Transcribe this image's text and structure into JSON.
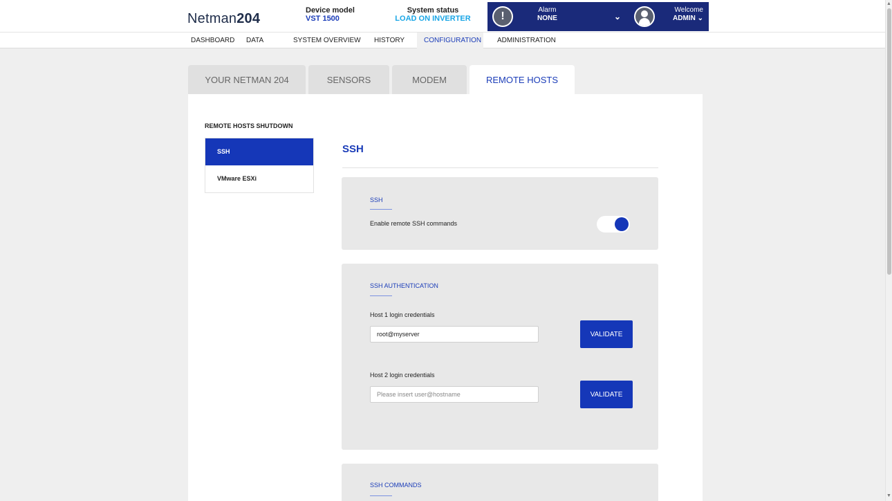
{
  "header": {
    "logo_text": "Netman",
    "logo_num": "204",
    "device_model_label": "Device model",
    "device_model_value": "VST 1500",
    "system_status_label": "System status",
    "system_status_value": "LOAD ON INVERTER",
    "alarm_label": "Alarm",
    "alarm_value": "NONE",
    "alarm_icon": "alarm-speech-bubble-icon",
    "welcome_label": "Welcome",
    "welcome_user": "ADMIN",
    "accent": "#1a2a7a"
  },
  "nav": {
    "items": [
      {
        "label": "DASHBOARD"
      },
      {
        "label": "DATA"
      },
      {
        "label": "SYSTEM OVERVIEW"
      },
      {
        "label": "HISTORY"
      },
      {
        "label": "CONFIGURATION"
      },
      {
        "label": "ADMINISTRATION"
      }
    ],
    "active": "CONFIGURATION"
  },
  "tabs": [
    {
      "label": "YOUR NETMAN 204"
    },
    {
      "label": "SENSORS"
    },
    {
      "label": "MODEM"
    },
    {
      "label": "REMOTE HOSTS"
    }
  ],
  "sidebar": {
    "title": "REMOTE HOSTS SHUTDOWN",
    "items": [
      {
        "label": "SSH"
      },
      {
        "label": "VMware ESXi"
      }
    ]
  },
  "section": {
    "title": "SSH",
    "ssh_card": {
      "title": "SSH",
      "enable_label": "Enable remote SSH commands",
      "enabled": true
    },
    "auth_card": {
      "title": "SSH AUTHENTICATION",
      "host1_label": "Host 1 login credentials",
      "host1_value": "root@myserver",
      "host2_label": "Host 2 login credentials",
      "host2_value": "",
      "host2_placeholder": "Please insert user@hostname",
      "validate_label": "VALIDATE"
    },
    "commands_card": {
      "title": "SSH COMMANDS"
    }
  }
}
